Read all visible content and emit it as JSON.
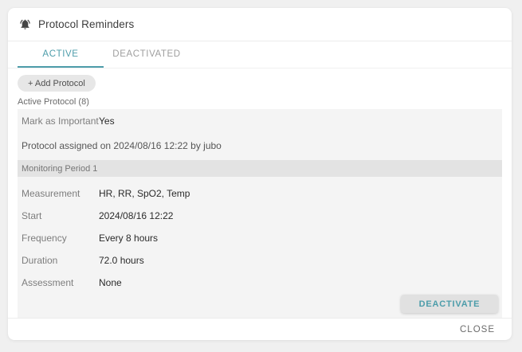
{
  "colors": {
    "accent": "#4d9daa"
  },
  "dialog": {
    "title": "Protocol Reminders",
    "tabs": [
      {
        "label": "ACTIVE",
        "active": true
      },
      {
        "label": "DEACTIVATED",
        "active": false
      }
    ],
    "add_button_label": "+ Add Protocol",
    "section_label": "Active Protocol (8)",
    "protocol": {
      "important": {
        "label": "Mark as Important",
        "value": "Yes"
      },
      "assigned_note": "Protocol assigned on 2024/08/16 12:22 by jubo",
      "period_header": "Monitoring Period 1",
      "fields": [
        {
          "label": "Measurement",
          "value": "HR, RR, SpO2, Temp"
        },
        {
          "label": "Start",
          "value": "2024/08/16 12:22"
        },
        {
          "label": "Frequency",
          "value": "Every 8 hours"
        },
        {
          "label": "Duration",
          "value": "72.0 hours"
        },
        {
          "label": "Assessment",
          "value": "None"
        }
      ],
      "deactivate_button_label": "DEACTIVATE"
    },
    "close_button_label": "CLOSE"
  }
}
